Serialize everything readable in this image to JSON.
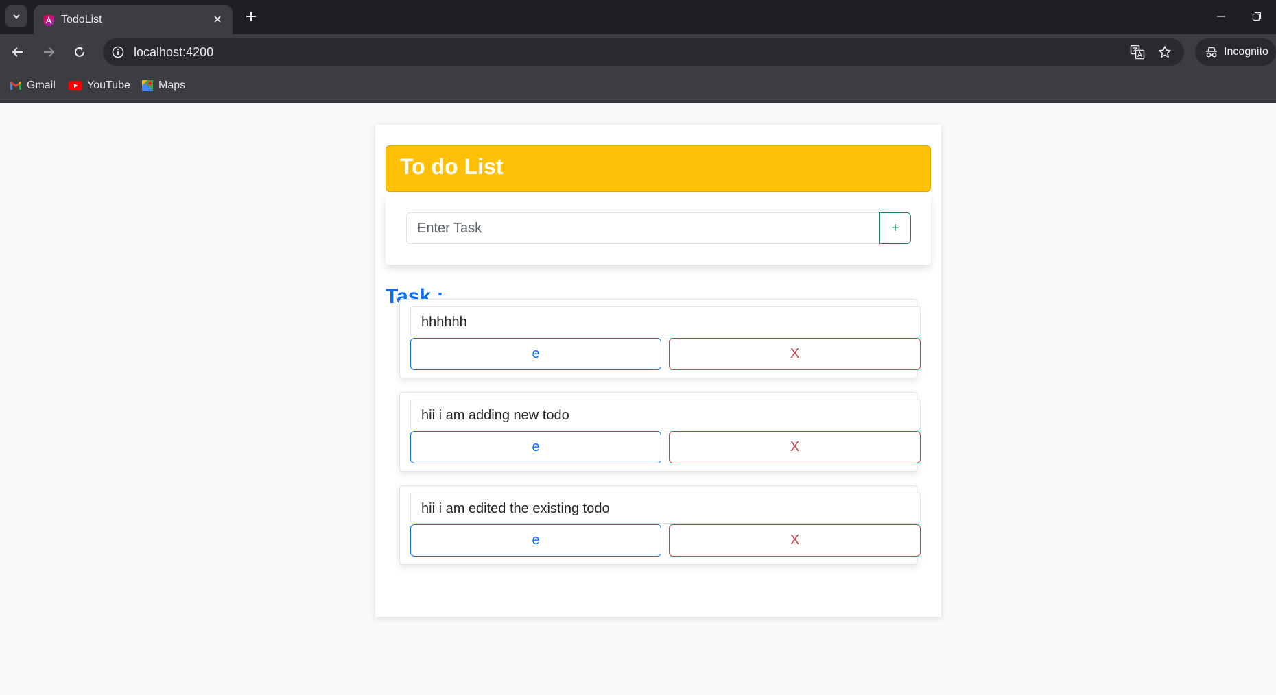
{
  "browser": {
    "tab_title": "TodoList",
    "url": "localhost:4200",
    "incognito_label": "Incognito",
    "bookmarks": [
      {
        "label": "Gmail",
        "icon": "gmail-icon"
      },
      {
        "label": "YouTube",
        "icon": "youtube-icon"
      },
      {
        "label": "Maps",
        "icon": "maps-icon"
      }
    ]
  },
  "app": {
    "title": "To do List",
    "input_placeholder": "Enter Task",
    "input_value": "",
    "add_button_label": "+",
    "task_heading": "Task :",
    "tasks": [
      {
        "text": "hhhhhh",
        "edit_label": "e",
        "delete_label": "X"
      },
      {
        "text": "hii i am adding new todo",
        "edit_label": "e",
        "delete_label": "X"
      },
      {
        "text": "hii i am edited the existing todo",
        "edit_label": "e",
        "delete_label": "X"
      }
    ]
  },
  "colors": {
    "header_bg": "#ffc107",
    "primary": "#0d6efd",
    "danger": "#dc3545",
    "success": "#198754"
  }
}
